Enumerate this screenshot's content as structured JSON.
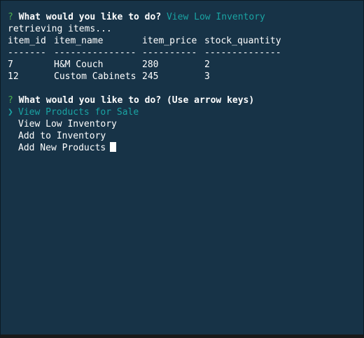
{
  "prompt1": {
    "mark": "?",
    "question": "What would you like to do?",
    "answer": "View Low Inventory"
  },
  "status": "retrieving items...",
  "table": {
    "headers": [
      "item_id",
      "item_name",
      "item_price",
      "stock_quantity"
    ],
    "separators": [
      "-------",
      "---------------",
      "----------",
      "--------------"
    ],
    "rows": [
      [
        "7",
        "H&M Couch",
        "280",
        "2"
      ],
      [
        "12",
        "Custom Cabinets",
        "245",
        "3"
      ]
    ]
  },
  "prompt2": {
    "mark": "?",
    "question": "What would you like to do?",
    "hint": "(Use arrow keys)",
    "pointer": "❯",
    "options": [
      "View Products for Sale",
      "View Low Inventory",
      "Add to Inventory",
      "Add New Products"
    ]
  }
}
